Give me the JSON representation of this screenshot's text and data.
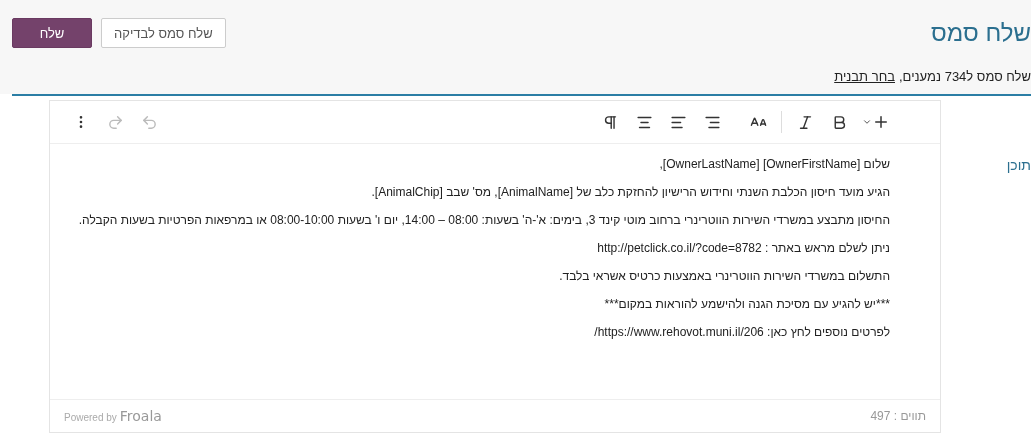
{
  "header": {
    "title": "שלח סמס",
    "buttons": [
      {
        "kind": "outline",
        "label": "שלח סמס לבדיקה"
      },
      {
        "kind": "primary",
        "label": "שלח"
      }
    ]
  },
  "recipients": {
    "text": "שלח סמס ל734 נמענים,",
    "link": "בחר תבנית"
  },
  "field_label": "תוכן",
  "toolbar": {
    "format_groups": [
      [
        {
          "kind": "insert",
          "disabled": false
        },
        {
          "kind": "bold",
          "disabled": false
        },
        {
          "kind": "italic",
          "disabled": false
        }
      ],
      [
        {
          "kind": "font-size",
          "disabled": false
        }
      ],
      [
        {
          "kind": "align-right",
          "disabled": false
        },
        {
          "kind": "align-left",
          "disabled": false
        },
        {
          "kind": "align-center",
          "disabled": false
        },
        {
          "kind": "paragraph",
          "disabled": false
        }
      ]
    ],
    "history": [
      {
        "kind": "undo",
        "disabled": true
      },
      {
        "kind": "redo",
        "disabled": true
      },
      {
        "kind": "more",
        "disabled": false
      }
    ]
  },
  "content": [
    "שלום [OwnerFirstName] [OwnerLastName],",
    "הגיע מועד חיסון הכלבת השנתי וחידוש הרישיון להחזקת כלב של [AnimalName], מס' שבב [AnimalChip].",
    "החיסון מתבצע במשרדי השירות הווטרינרי ברחוב מוטי קינד 3, בימים: א'-ה'  בשעות: 08:00 – 14:00, יום ו' בשעות 08:00-10:00  או במרפאות הפרטיות בשעות הקבלה.",
    "ניתן לשלם מראש באתר : http://petclick.co.il/?code=8782",
    "התשלום במשרדי השירות הווטרינרי באמצעות כרטיס אשראי בלבד.",
    "***יש להגיע עם מסיכת הגנה ולהישמע להוראות במקום***",
    "לפרטים נוספים לחץ כאן: https://www.rehovot.muni.il/206/"
  ],
  "footer": {
    "powered": "Powered by",
    "brand": "Froala",
    "char_count": "תווים : 497"
  }
}
